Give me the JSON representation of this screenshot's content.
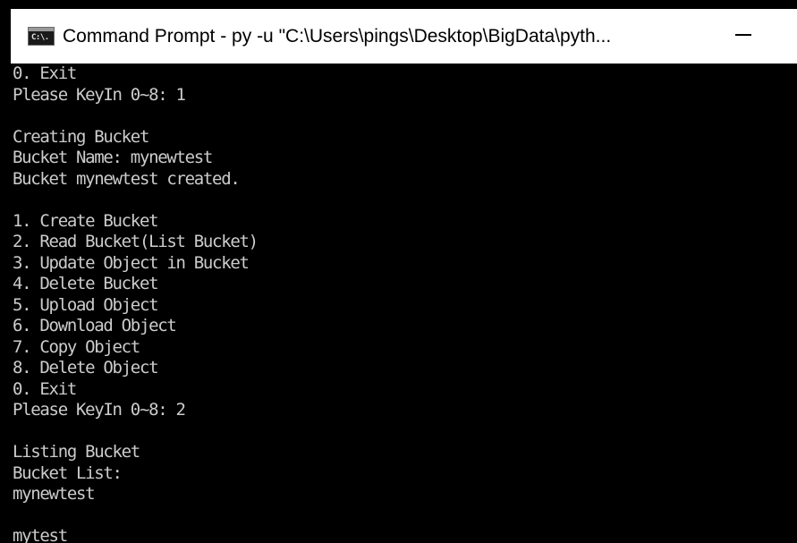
{
  "window": {
    "title": "Command Prompt - py  -u \"C:\\Users\\pings\\Desktop\\BigData\\pyth...",
    "icon": "command-prompt-icon",
    "icon_glyph": "C:\\."
  },
  "console": {
    "lines": [
      "0. Exit",
      "Please KeyIn 0~8: 1",
      "",
      "Creating Bucket",
      "Bucket Name: mynewtest",
      "Bucket mynewtest created.",
      "",
      "1. Create Bucket",
      "2. Read Bucket(List Bucket)",
      "3. Update Object in Bucket",
      "4. Delete Bucket",
      "5. Upload Object",
      "6. Download Object",
      "7. Copy Object",
      "8. Delete Object",
      "0. Exit",
      "Please KeyIn 0~8: 2",
      "",
      "Listing Bucket",
      "Bucket List:",
      "mynewtest",
      "",
      "mytest"
    ]
  },
  "colors": {
    "console_bg": "#000000",
    "console_text": "#cccccc",
    "titlebar_bg": "#ffffff"
  }
}
